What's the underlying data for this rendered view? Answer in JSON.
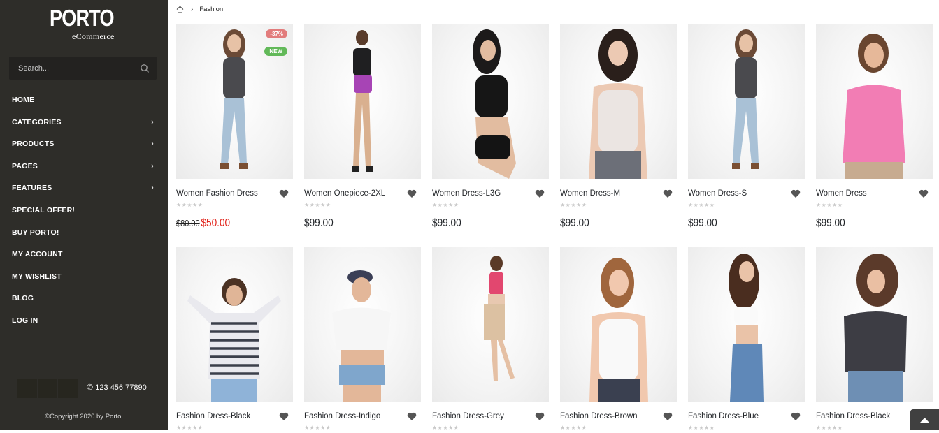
{
  "logo": {
    "main": "PORTO",
    "sub": "eCommerce"
  },
  "search": {
    "placeholder": "Search..."
  },
  "nav": [
    {
      "label": "HOME",
      "arrow": ""
    },
    {
      "label": "CATEGORIES",
      "arrow": "›"
    },
    {
      "label": "PRODUCTS",
      "arrow": "›"
    },
    {
      "label": "PAGES",
      "arrow": "›"
    },
    {
      "label": "FEATURES",
      "arrow": "›"
    },
    {
      "label": "SPECIAL OFFER!",
      "arrow": ""
    },
    {
      "label": "BUY PORTO!",
      "arrow": ""
    },
    {
      "label": "MY ACCOUNT",
      "arrow": ""
    },
    {
      "label": "MY WISHLIST",
      "arrow": ""
    },
    {
      "label": "BLOG",
      "arrow": ""
    },
    {
      "label": "LOG IN",
      "arrow": ""
    }
  ],
  "footer": {
    "phone": "123 456 77890",
    "copyright": "©Copyright 2020 by Porto."
  },
  "breadcrumb": {
    "current": "Fashion"
  },
  "products": [
    {
      "name": "Women Fashion Dress",
      "price": "$50.00",
      "old_price": "$80.00",
      "badge_discount": "-37%",
      "badge_new": "NEW",
      "stars": "★★★★★"
    },
    {
      "name": "Women Onepiece-2XL",
      "price": "$99.00",
      "stars": "★★★★★"
    },
    {
      "name": "Women Dress-L3G",
      "price": "$99.00",
      "stars": "★★★★★"
    },
    {
      "name": "Women Dress-M",
      "price": "$99.00",
      "stars": "★★★★★"
    },
    {
      "name": "Women Dress-S",
      "price": "$99.00",
      "stars": "★★★★★"
    },
    {
      "name": "Women Dress",
      "price": "$99.00",
      "stars": "★★★★★"
    },
    {
      "name": "Fashion Dress-Black",
      "stars": "★★★★★"
    },
    {
      "name": "Fashion Dress-Indigo",
      "stars": "★★★★★"
    },
    {
      "name": "Fashion Dress-Grey",
      "stars": "★★★★★"
    },
    {
      "name": "Fashion Dress-Brown",
      "stars": "★★★★★"
    },
    {
      "name": "Fashion Dress-Blue",
      "stars": "★★★★★"
    },
    {
      "name": "Fashion Dress-Black",
      "stars": "★★★★★"
    }
  ],
  "colors": {
    "sidebar_bg": "#2e2d29",
    "sale_price": "#e2231a",
    "badge_discount": "#e27c7c",
    "badge_new": "#62b959"
  },
  "icons": {
    "search": "search-icon",
    "wishlist": "heart-icon",
    "home": "home-icon",
    "phone": "phone-icon",
    "scroll_top": "chevron-up-icon"
  }
}
